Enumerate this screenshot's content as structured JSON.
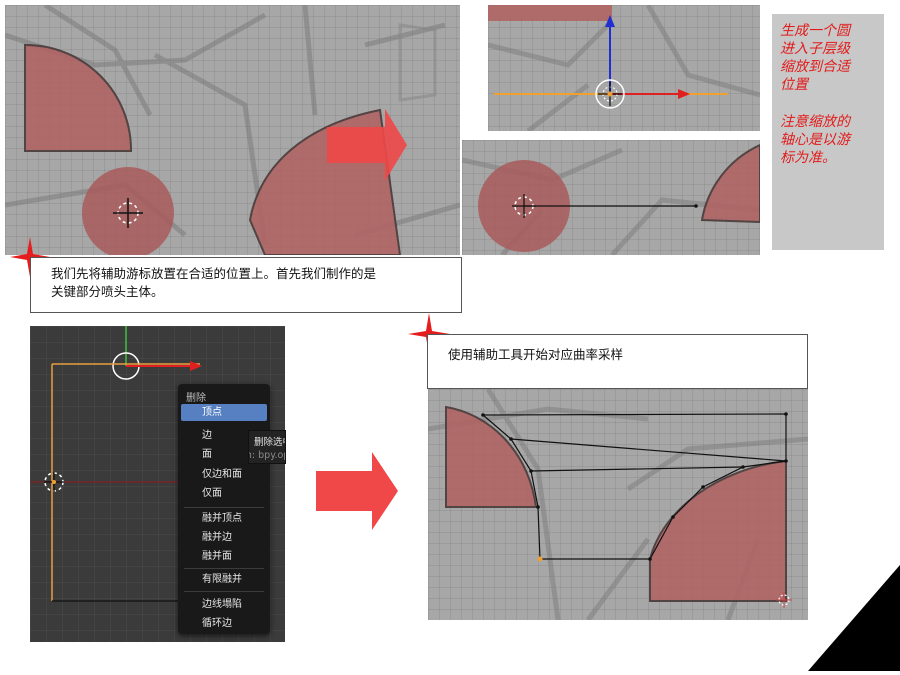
{
  "note": {
    "lines_top": [
      "生成一个圆",
      "进入子层级",
      "缩放到合适",
      "位置"
    ],
    "lines_bottom": [
      "注意缩放的",
      "轴心是以游",
      "标为准。"
    ]
  },
  "caption_top": {
    "line1": "我们先将辅助游标放置在合适的位置上。首先我们制作的是",
    "line2": "关键部分喷头主体。"
  },
  "caption_right": {
    "text": "使用辅助工具开始对应曲率采样"
  },
  "menu": {
    "title": "删除",
    "items": [
      "顶点",
      "边",
      "面",
      "仅边和面",
      "仅面",
      "融并顶点",
      "融并边",
      "融并面",
      "有限融并",
      "边线塌陷",
      "循环边"
    ]
  },
  "tooltip": {
    "title": "删除选中",
    "python": "Python: bpy.ops.mesh.delete"
  },
  "colors": {
    "accent_red": "#e21b1b",
    "menu_highlight": "#5680c2",
    "arrow_red": "#f04848"
  }
}
